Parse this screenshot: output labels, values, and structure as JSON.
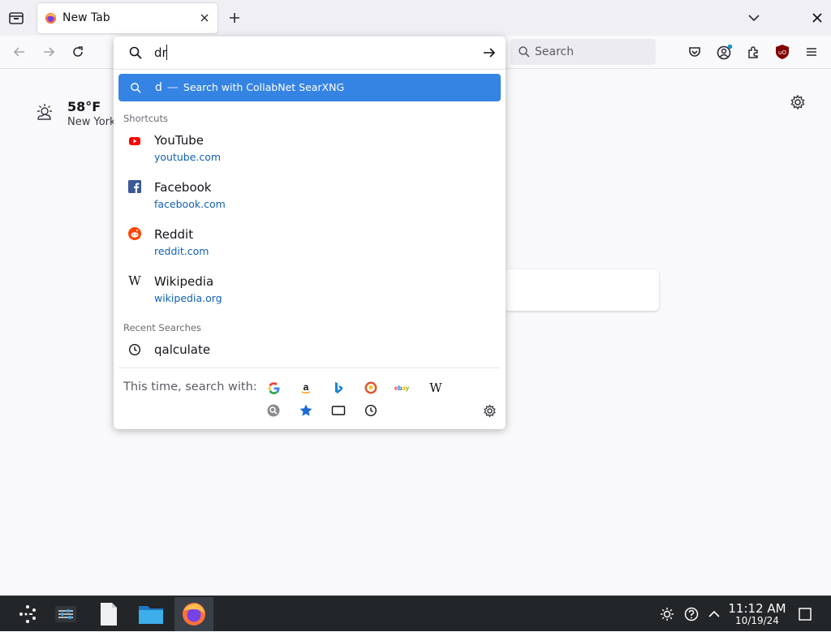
{
  "window": {
    "tab_title": "New Tab",
    "tab_close_icon": "close-icon",
    "new_tab_icon": "plus-icon",
    "list_all_tabs_icon": "chevron-down-icon",
    "window_close_icon": "close-icon"
  },
  "toolbar": {
    "search_placeholder": "Search"
  },
  "urlbar": {
    "typed_value": "dr",
    "heuristic": {
      "query": "d",
      "separator": "—",
      "action": "Search with CollabNet SearXNG"
    },
    "shortcuts_label": "Shortcuts",
    "shortcuts": [
      {
        "title": "YouTube",
        "url": "youtube.com",
        "icon": "youtube-icon"
      },
      {
        "title": "Facebook",
        "url": "facebook.com",
        "icon": "facebook-icon"
      },
      {
        "title": "Reddit",
        "url": "reddit.com",
        "icon": "reddit-icon"
      },
      {
        "title": "Wikipedia",
        "url": "wikipedia.org",
        "icon": "wikipedia-icon"
      }
    ],
    "recent_label": "Recent Searches",
    "recent": [
      {
        "text": "qalculate",
        "icon": "clock-icon"
      }
    ],
    "oneoff_label": "This time, search with:",
    "oneoff_engines": [
      "google-icon",
      "amazon-icon",
      "bing-icon",
      "duckduckgo-icon",
      "ebay-icon",
      "wikipedia-icon"
    ],
    "oneoff_modes": [
      "searxng-icon",
      "bookmarks-star-icon",
      "tabs-icon",
      "history-clock-icon"
    ]
  },
  "newtab": {
    "weather_temp": "58°F",
    "weather_city": "New York"
  },
  "taskbar": {
    "time": "11:12 AM",
    "date": "10/19/24"
  },
  "colors": {
    "accent": "#3584e4",
    "link": "#1060b8",
    "taskbar": "#232629"
  }
}
